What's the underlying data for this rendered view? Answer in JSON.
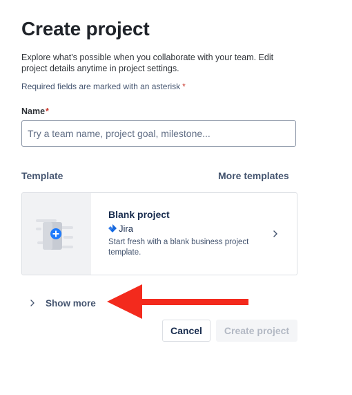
{
  "header": {
    "title": "Create project",
    "description": "Explore what's possible when you collaborate with your team. Edit project details anytime in project settings.",
    "required_note": "Required fields are marked with an asterisk",
    "required_asterisk": "*"
  },
  "name_field": {
    "label": "Name",
    "required_marker": "*",
    "placeholder": "Try a team name, project goal, milestone...",
    "value": ""
  },
  "template_section": {
    "label": "Template",
    "more_templates": "More templates",
    "card": {
      "title": "Blank project",
      "product": "Jira",
      "description": "Start fresh with a blank business project template.",
      "thumbnail_icon": "plus-icon",
      "chevron_icon": "chevron-right-icon"
    }
  },
  "show_more": {
    "label": "Show more",
    "icon": "chevron-right-icon"
  },
  "annotation": {
    "type": "arrow",
    "color": "#f32a1d",
    "points_to": "show-more"
  },
  "footer": {
    "cancel_label": "Cancel",
    "create_label": "Create project",
    "create_disabled": true
  },
  "colors": {
    "required": "#c9372c",
    "jira_blue": "#1868db",
    "accent_blue": "#1d7afc"
  }
}
